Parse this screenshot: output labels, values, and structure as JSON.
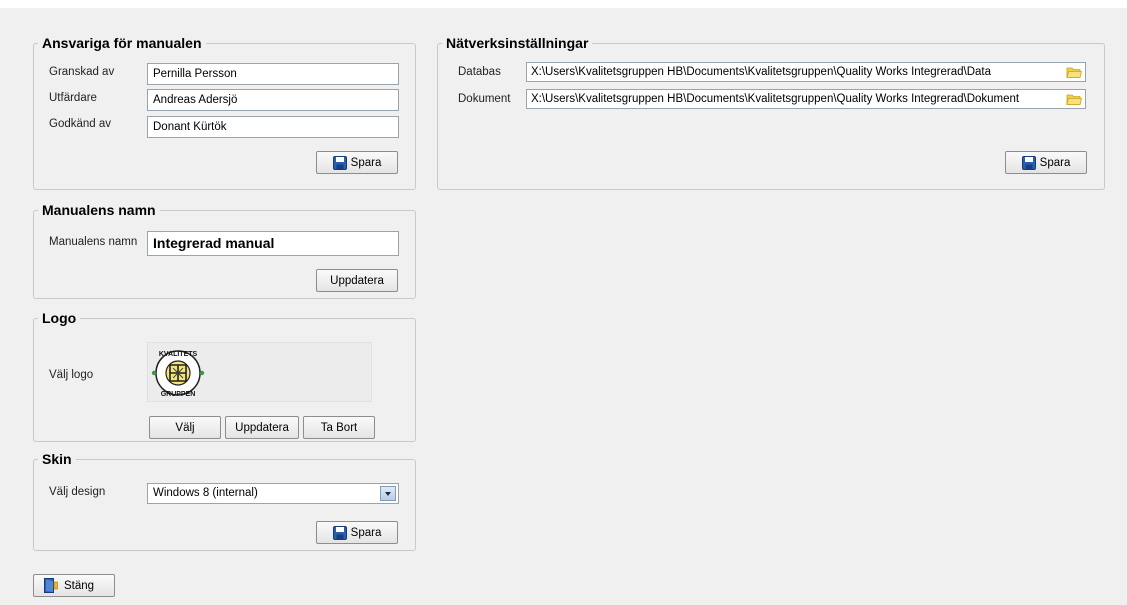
{
  "responsible": {
    "title": "Ansvariga för manualen",
    "reviewed_label": "Granskad av",
    "reviewed_value": "Pernilla Persson",
    "issuer_label": "Utfärdare",
    "issuer_value": "Andreas Adersjö",
    "approved_label": "Godkänd av",
    "approved_value": "Donant Kürtök",
    "save_label": "Spara"
  },
  "manual_name": {
    "title": "Manualens namn",
    "name_label": "Manualens namn",
    "name_value": "Integrerad manual",
    "update_label": "Uppdatera"
  },
  "logo": {
    "title": "Logo",
    "choose_label": "Välj logo",
    "logo_text_top": "KVALITETS",
    "logo_text_bottom": "GRUPPEN",
    "choose_button": "Välj",
    "update_button": "Uppdatera",
    "remove_button": "Ta Bort"
  },
  "skin": {
    "title": "Skin",
    "design_label": "Välj design",
    "design_value": "Windows 8 (internal)",
    "save_label": "Spara"
  },
  "network": {
    "title": "Nätverksinställningar",
    "database_label": "Databas",
    "database_path": "X:\\Users\\Kvalitetsgruppen HB\\Documents\\Kvalitetsgruppen\\Quality Works Integrerad\\Data",
    "documents_label": "Dokument",
    "documents_path": "X:\\Users\\Kvalitetsgruppen HB\\Documents\\Kvalitetsgruppen\\Quality Works Integrerad\\Dokument",
    "save_label": "Spara"
  },
  "footer": {
    "close_label": "Stäng"
  },
  "colors": {
    "background": "#f0f0f0",
    "disk_icon": "#2a5fb0",
    "folder_icon": "#f2cf4a"
  }
}
